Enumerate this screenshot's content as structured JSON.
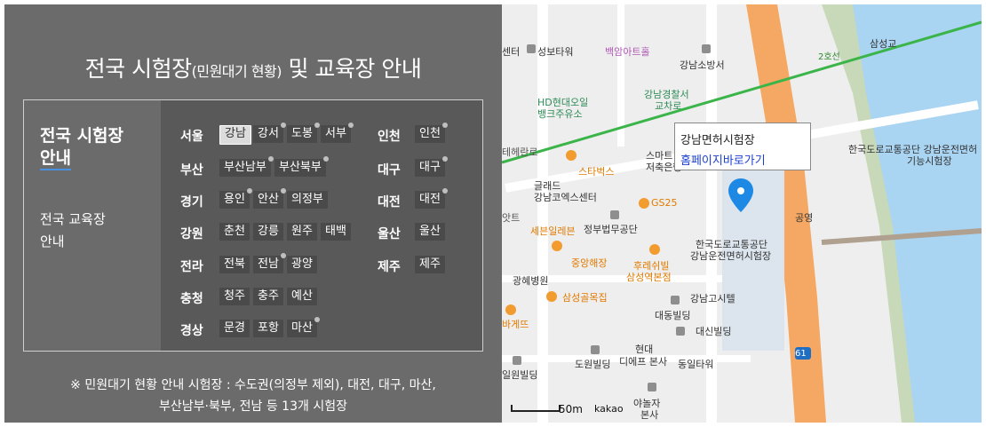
{
  "panel": {
    "title_main": "전국 시험장",
    "title_small": "(민원대기 현황)",
    "title_rest": " 및 교육장 안내",
    "side_active_line1": "전국 시험장",
    "side_active_line2": "안내",
    "side_other_line1": "전국 교육장",
    "side_other_line2": "안내",
    "note_line1": "※ 민원대기 현황 안내 시험장 : 수도권(의정부 제외), 대전, 대구, 마산,",
    "note_line2": "부산남부·북부, 전남 등 13개 시험장"
  },
  "regions": {
    "seoul": {
      "name": "서울",
      "centers": [
        "강남",
        "강서",
        "도봉",
        "서부"
      ]
    },
    "busan": {
      "name": "부산",
      "centers": [
        "부산남부",
        "부산북부"
      ]
    },
    "gyeonggi": {
      "name": "경기",
      "centers": [
        "용인",
        "안산",
        "의정부"
      ]
    },
    "gangwon": {
      "name": "강원",
      "centers": [
        "춘천",
        "강릉",
        "원주",
        "태백"
      ]
    },
    "jeolla": {
      "name": "전라",
      "centers": [
        "전북",
        "전남",
        "광양"
      ]
    },
    "chungcheong": {
      "name": "충청",
      "centers": [
        "청주",
        "충주",
        "예산"
      ]
    },
    "gyeongsang": {
      "name": "경상",
      "centers": [
        "문경",
        "포항",
        "마산"
      ]
    },
    "incheon": {
      "name": "인천",
      "centers": [
        "인천"
      ]
    },
    "daegu": {
      "name": "대구",
      "centers": [
        "대구"
      ]
    },
    "daejeon": {
      "name": "대전",
      "centers": [
        "대전"
      ]
    },
    "ulsan": {
      "name": "울산",
      "centers": [
        "울산"
      ]
    },
    "jeju": {
      "name": "제주",
      "centers": [
        "제주"
      ]
    }
  },
  "map": {
    "info_title": "강남면허시험장",
    "info_link": "홈페이지바로가기",
    "scale": "50m",
    "brand": "kakao",
    "labels": {
      "l1": "센터",
      "l2": "성보타워",
      "l3": "백암아트홀",
      "l4": "강남소방서",
      "l5": "HD현대오일",
      "l6": "뱅크주유소",
      "l7": "강남경찰서",
      "l8": "교차로",
      "l9": "스마트",
      "l10": "저축은행",
      "l11": "스타벅스",
      "l12": "글래드",
      "l13": "강남코엑스센터",
      "l14": "GS25",
      "l15": "세븐일레븐",
      "l16": "정부법무공단",
      "l17": "중앙해장",
      "l18": "후레쉬빌",
      "l19": "삼성역본점",
      "l20": "광혜병원",
      "l21": "삼성골목집",
      "l22": "한국도로교통공단",
      "l23": "강남운전면허시험장",
      "l24": "강남고시텔",
      "l25": "대동빌딩",
      "l26": "대신빌딩",
      "l27": "현대",
      "l28": "디에프 본사",
      "l29": "도원빌딩",
      "l30": "동일타워",
      "l31": "일원빌딩",
      "l32": "야놀자",
      "l33": "본사",
      "l34": "바게뜨",
      "l35": "한국도로교통공단 강남운전면허",
      "l36": "기능시험장",
      "l37": "공영",
      "l38": "삼성교",
      "l39": "2호선",
      "l40": "테헤란로",
      "l41": "61",
      "l42": "앗트"
    }
  },
  "colors": {
    "panel_bg": "#6b6b6b",
    "chip_bg": "#4a4a4a",
    "active_underline": "#4a90e2",
    "river": "#a9d4f2",
    "road_orange": "#f5a863",
    "subway_line": "#3bb54a",
    "marker": "#1e88e5"
  }
}
